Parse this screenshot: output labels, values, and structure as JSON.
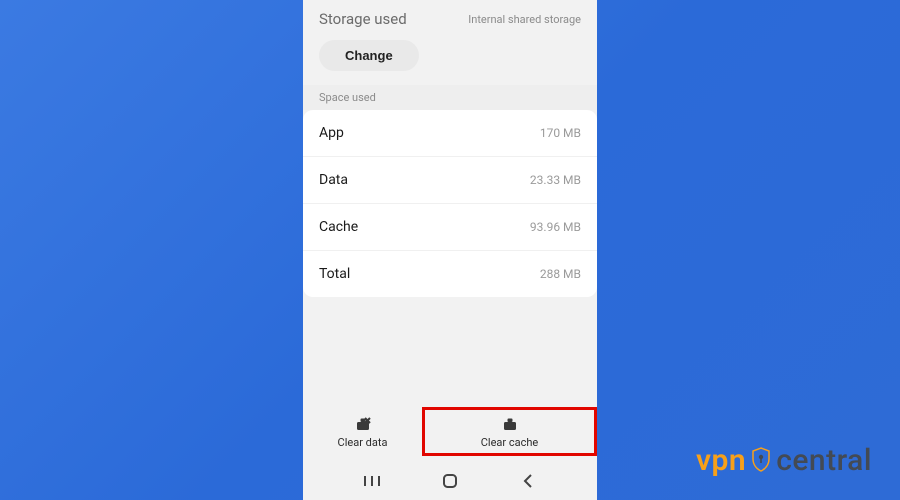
{
  "header": {
    "title": "Storage used",
    "subtitle": "Internal shared storage",
    "change_label": "Change"
  },
  "section": {
    "space_used_label": "Space used"
  },
  "rows": {
    "app": {
      "label": "App",
      "value": "170 MB"
    },
    "data": {
      "label": "Data",
      "value": "23.33 MB"
    },
    "cache": {
      "label": "Cache",
      "value": "93.96 MB"
    },
    "total": {
      "label": "Total",
      "value": "288 MB"
    }
  },
  "actions": {
    "clear_data": "Clear data",
    "clear_cache": "Clear cache"
  },
  "watermark": {
    "left": "vpn",
    "right": "central"
  }
}
